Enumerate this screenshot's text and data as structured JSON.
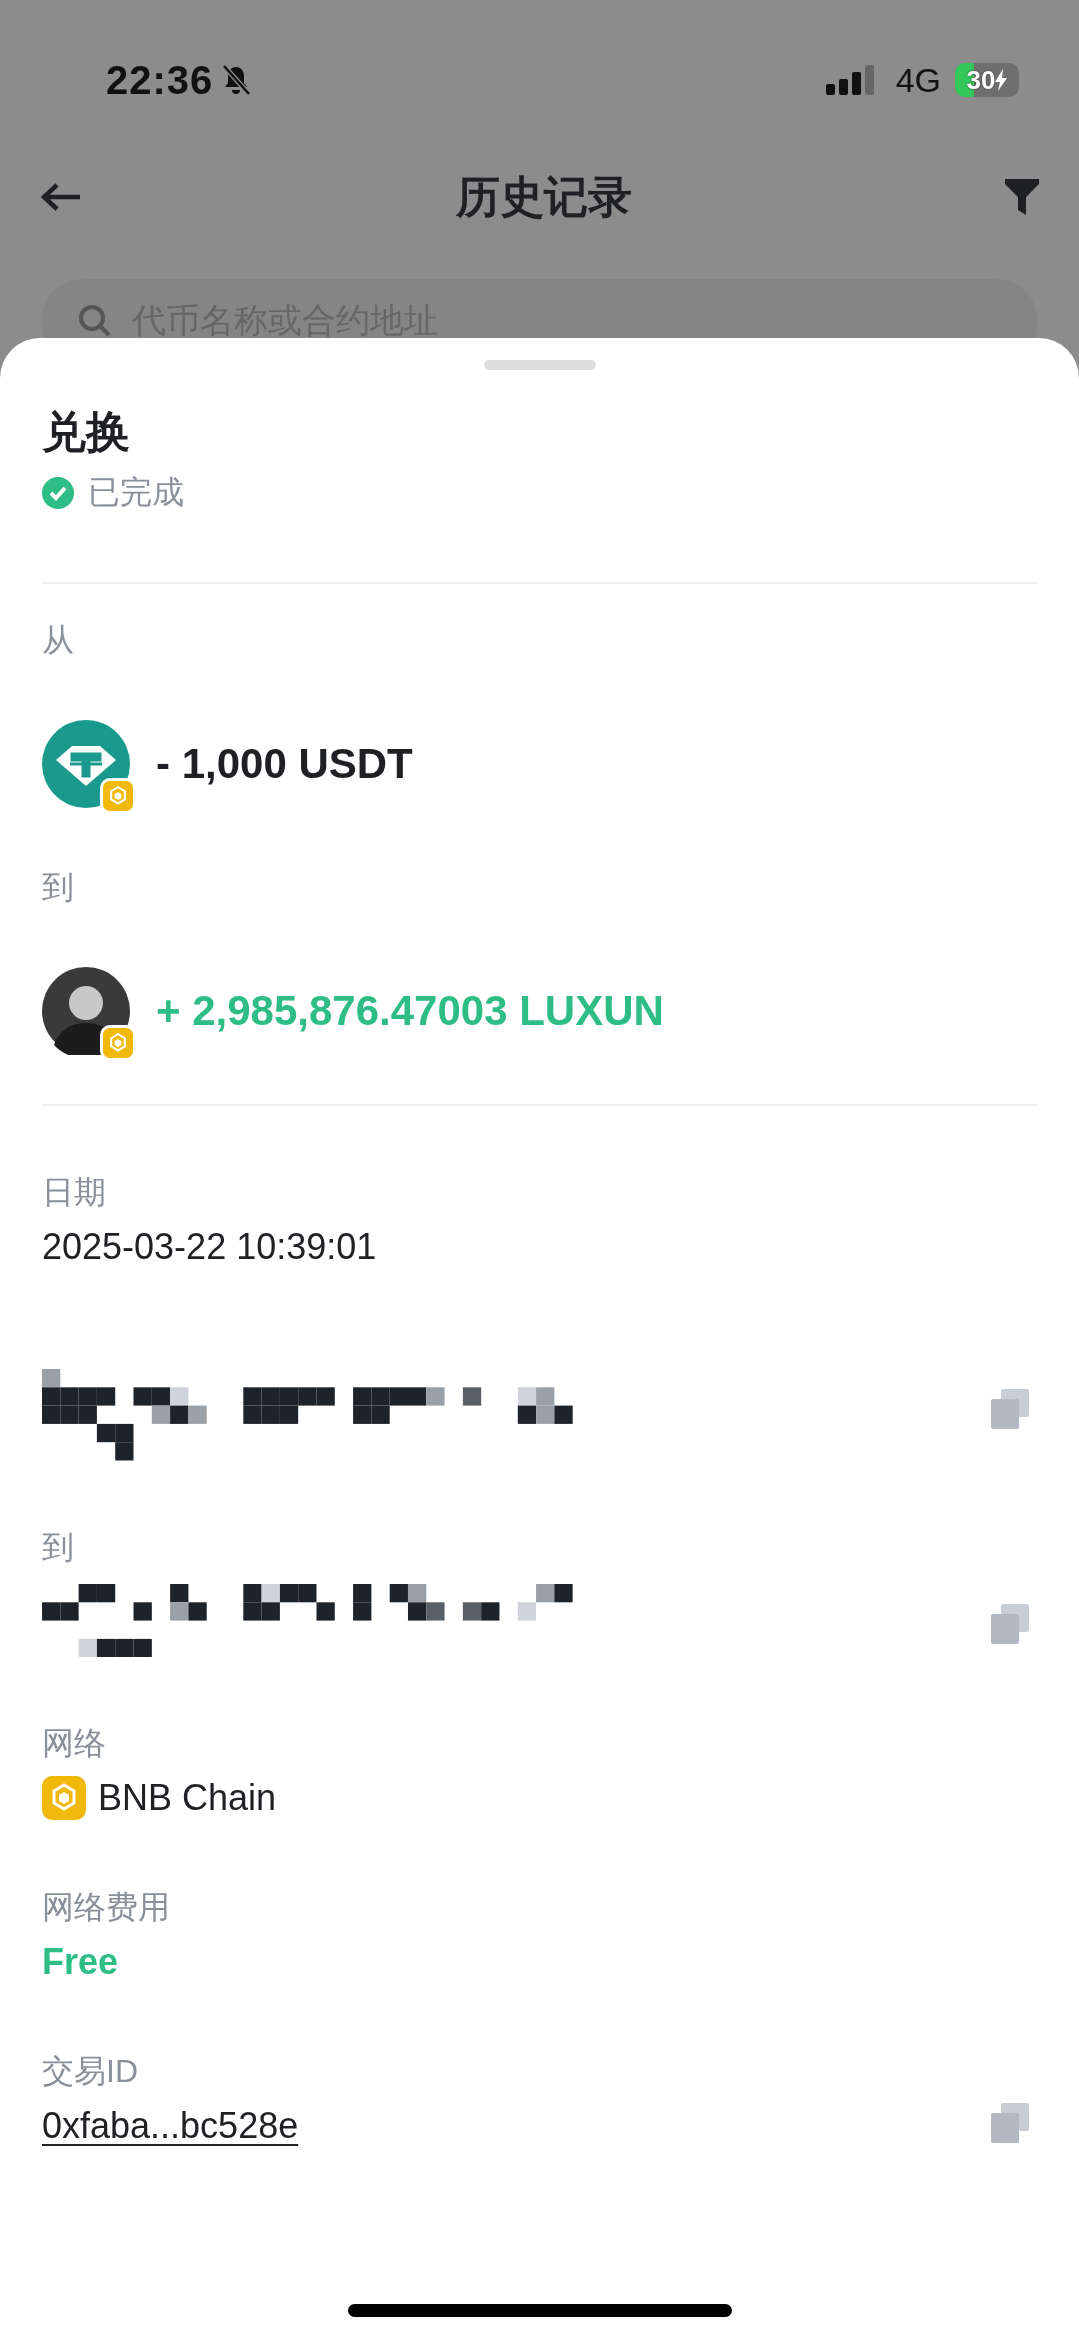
{
  "status_bar": {
    "time": "22:36",
    "silent": true,
    "network": "4G",
    "battery": "30",
    "charging": true
  },
  "header": {
    "title": "历史记录"
  },
  "search": {
    "placeholder": "代币名称或合约地址"
  },
  "sheet": {
    "title": "兑换",
    "status": "已完成",
    "legs": [
      {
        "label": "从",
        "amount": "- 1,000 USDT"
      },
      {
        "label": "到",
        "amount": "+ 2,985,876.47003 LUXUN"
      }
    ],
    "fields": [
      {
        "kind": "text",
        "label": "日期",
        "value": "2025-03-22 10:39:01"
      },
      {
        "kind": "redacted",
        "copyable": true
      },
      {
        "kind": "redacted",
        "label": "到",
        "copyable": true
      },
      {
        "kind": "network",
        "label": "网络",
        "value": "BNB Chain"
      },
      {
        "kind": "fee",
        "label": "网络费用",
        "value": "Free"
      },
      {
        "kind": "link",
        "label": "交易ID",
        "value": "0xfaba...bc528e",
        "copyable": true
      }
    ]
  }
}
